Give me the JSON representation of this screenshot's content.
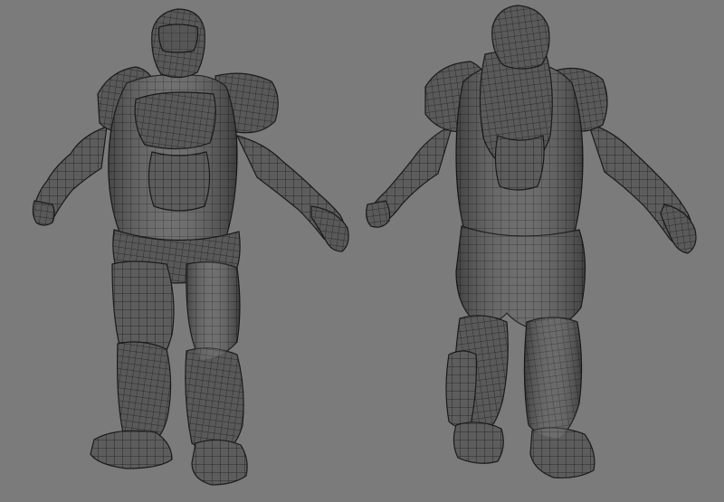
{
  "viewport": {
    "background_color": "#7b7b7b",
    "mesh_fill_color": "#5d5d5d",
    "mesh_shade_color": "#3e3e3e",
    "mesh_highlight_color": "#8a8a8a",
    "wire_color": "#1c1c1c"
  },
  "models": [
    {
      "view": "front",
      "icon": "armored-character-front-icon"
    },
    {
      "view": "back",
      "icon": "armored-character-back-icon"
    }
  ]
}
